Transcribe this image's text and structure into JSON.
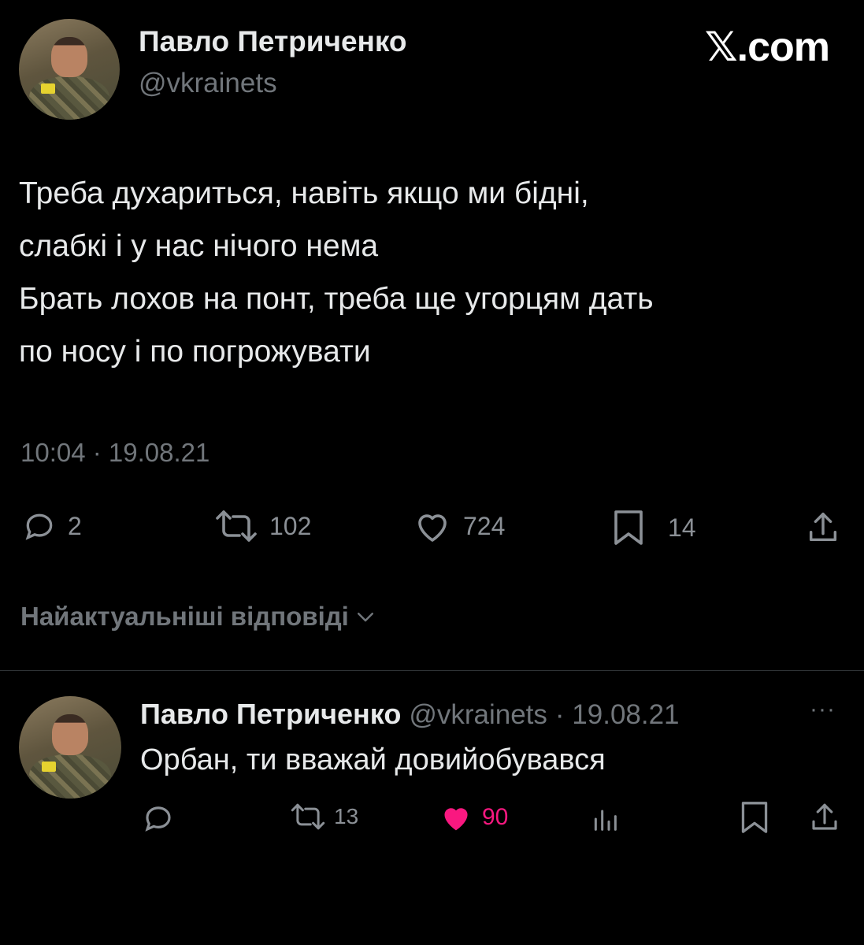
{
  "header": {
    "display_name": "Павло Петриченко",
    "handle": "@vkrainets",
    "site_logo": "𝕏.com"
  },
  "tweet": {
    "lines": [
      "Треба духариться, навіть якщо ми бідні,",
      "слабкі і у нас нічого нема",
      "Брать лохов на понт, треба ще угорцям дать",
      "по носу і по погрожувати"
    ],
    "timestamp": "10:04 · 19.08.21",
    "actions": {
      "replies": "2",
      "reposts": "102",
      "likes": "724",
      "bookmarks": "14"
    }
  },
  "replies_sort": {
    "label": "Найактуальніші відповіді"
  },
  "reply": {
    "display_name": "Павло Петриченко",
    "handle": "@vkrainets",
    "date": "· 19.08.21",
    "more": "···",
    "text": "Орбан, ти вважай довийобувався",
    "actions": {
      "reposts": "13",
      "likes": "90"
    }
  },
  "colors": {
    "background": "#000000",
    "text": "#e7e9ea",
    "muted": "#71767b",
    "like_active": "#f91880"
  }
}
